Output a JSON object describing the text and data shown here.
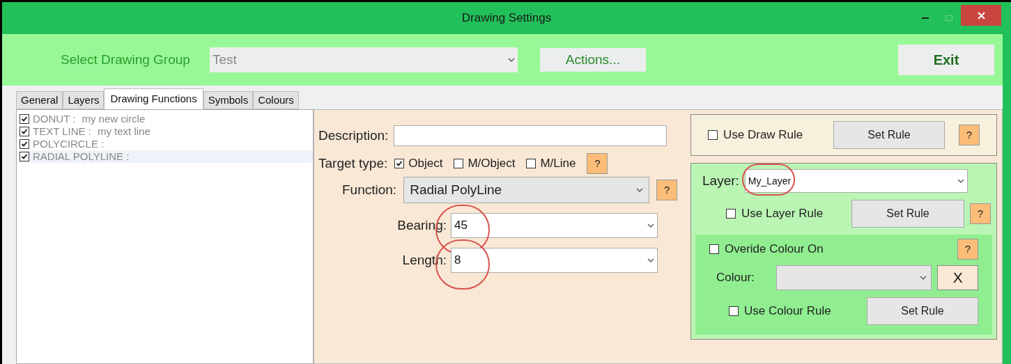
{
  "window": {
    "title": "Drawing Settings"
  },
  "toolbar": {
    "group_label": "Select Drawing Group",
    "group_value": "Test",
    "actions_button": "Actions...",
    "exit_button": "Exit"
  },
  "tabs": [
    {
      "label": "General",
      "selected": false
    },
    {
      "label": "Layers",
      "selected": false
    },
    {
      "label": "Drawing Functions",
      "selected": true
    },
    {
      "label": "Symbols",
      "selected": false
    },
    {
      "label": "Colours",
      "selected": false
    }
  ],
  "functions": [
    {
      "name": "DONUT :",
      "description": "my new circle",
      "checked": true,
      "selected": false
    },
    {
      "name": "TEXT LINE :",
      "description": "my text line",
      "checked": true,
      "selected": false
    },
    {
      "name": "POLYCIRCLE :",
      "checked": true,
      "selected": false
    },
    {
      "name": "RADIAL POLYLINE :",
      "checked": true,
      "selected": true
    }
  ],
  "form": {
    "description_label": "Description:",
    "target_label": "Target type:",
    "targets": [
      {
        "label": "Object",
        "checked": true
      },
      {
        "label": "M/Object",
        "checked": false
      },
      {
        "label": "M/Line",
        "checked": false
      }
    ],
    "function_label": "Function:",
    "function_value": "Radial PolyLine",
    "bearing_label": "Bearing:",
    "bearing_value": "45",
    "bearing_annotated": true,
    "length_label": "Length:",
    "length_value": "8",
    "length_annotated": true,
    "help": "?"
  },
  "draw_rule": {
    "label": "Use Draw Rule",
    "checked": false,
    "button": "Set Rule",
    "help": "?"
  },
  "layer": {
    "label": "Layer:",
    "value": "My_Layer",
    "annotated": true,
    "rule_label": "Use Layer Rule",
    "rule_checked": false,
    "button": "Set Rule",
    "help": "?"
  },
  "colour": {
    "override_label": "Overide Colour On",
    "override_checked": false,
    "help": "?",
    "colour_label": "Colour:",
    "clear_button": "X",
    "rule_label": "Use Colour Rule",
    "rule_checked": false,
    "button": "Set Rule"
  }
}
